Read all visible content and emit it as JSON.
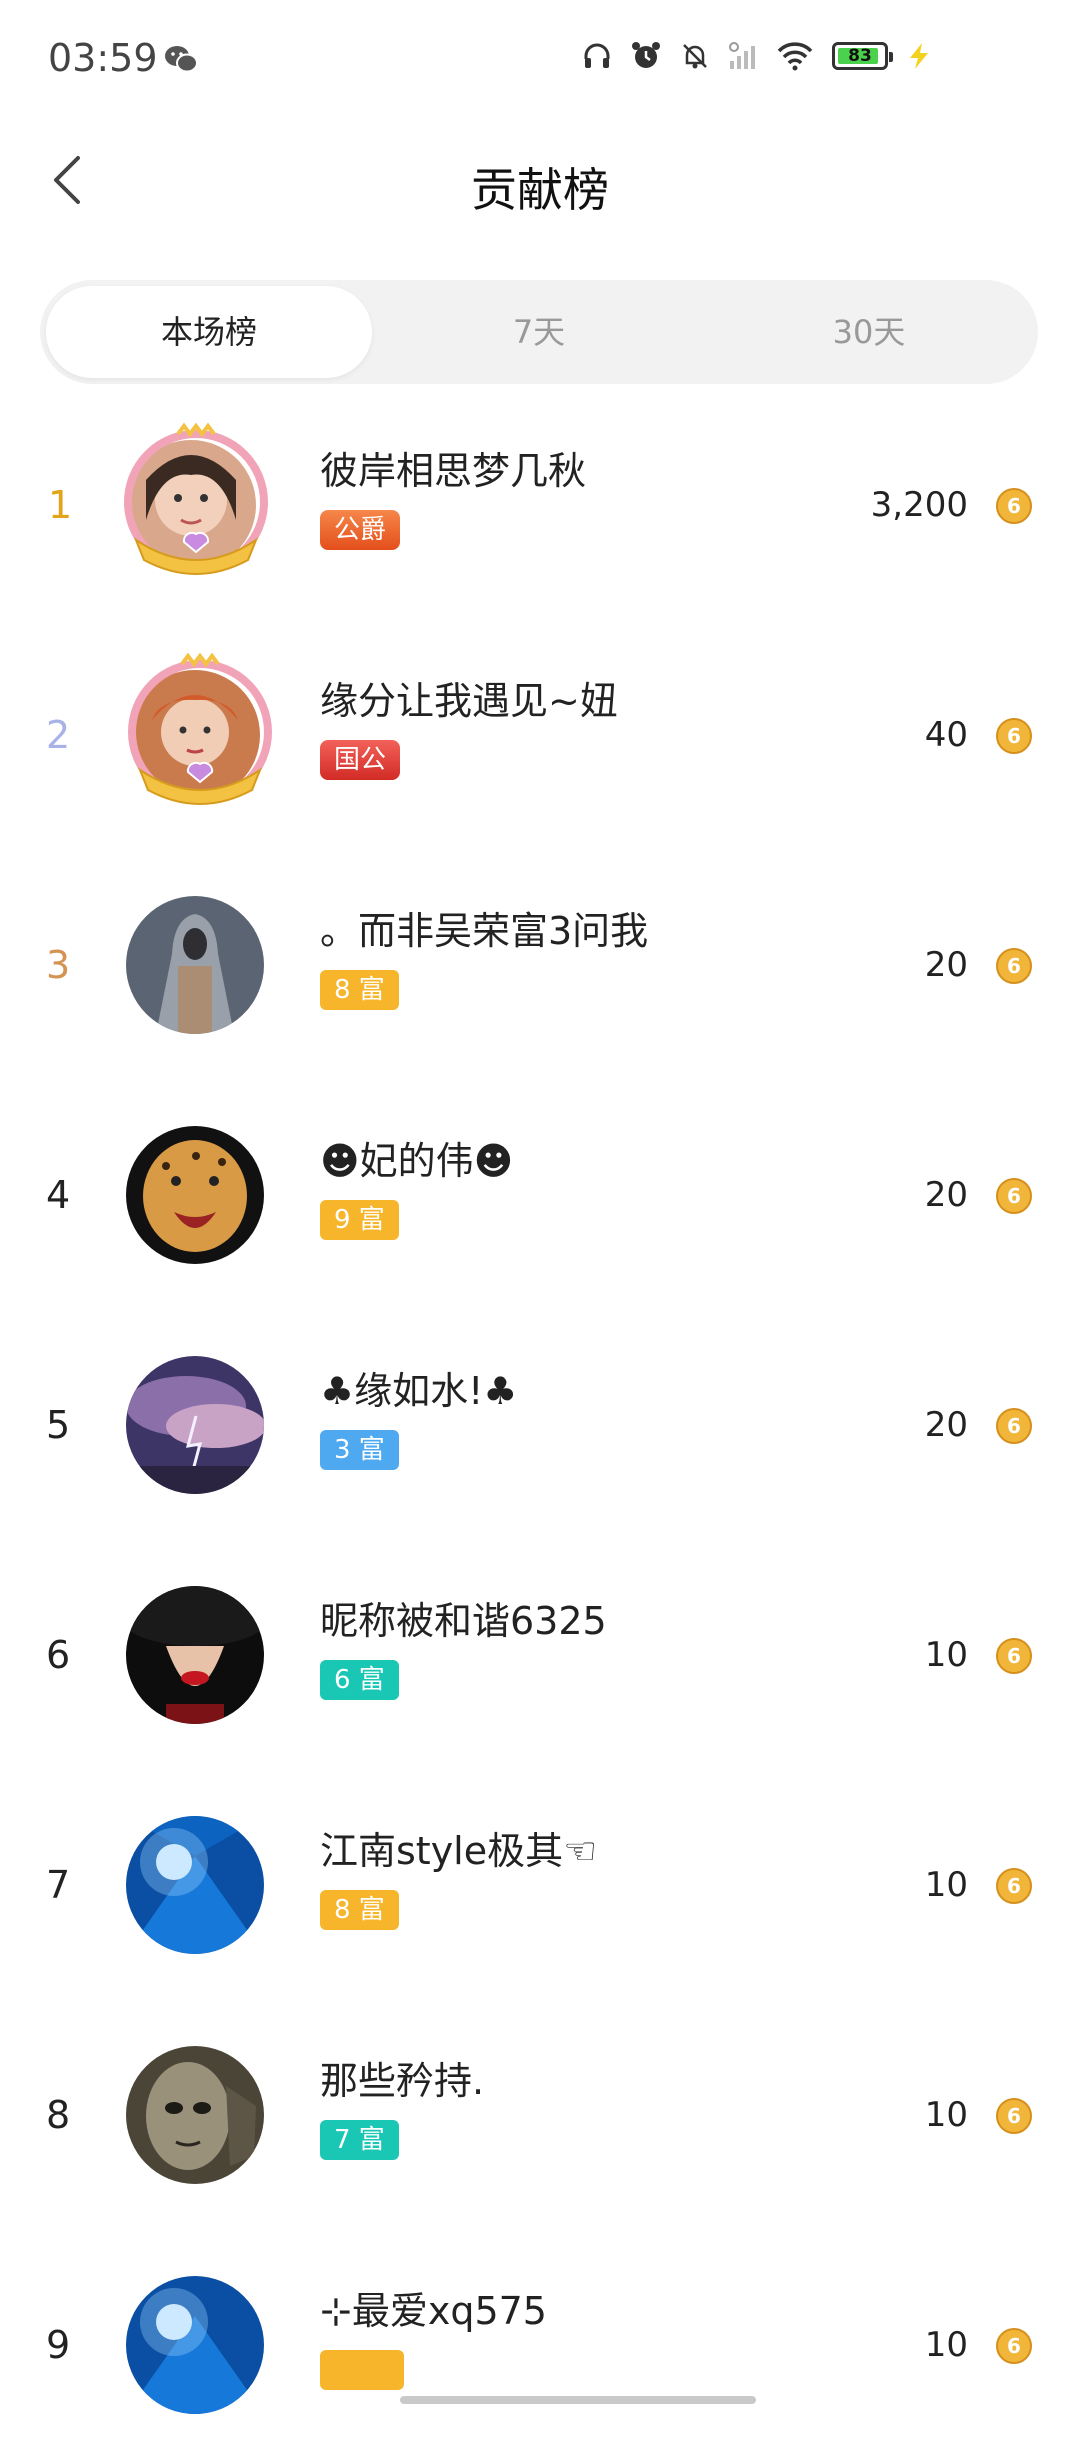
{
  "status_bar": {
    "time": "03:59",
    "battery": "83",
    "icons": [
      "wechat-icon",
      "headphones-icon",
      "alarm-icon",
      "mute-bell-icon",
      "signal-icon",
      "wifi-icon",
      "battery-icon",
      "charging-icon"
    ]
  },
  "header": {
    "title": "贡献榜",
    "back_icon": "chevron-left-icon"
  },
  "tabs": [
    {
      "label": "本场榜",
      "active": true
    },
    {
      "label": "7天",
      "active": false
    },
    {
      "label": "30天",
      "active": false
    }
  ],
  "colors": {
    "rank1": "#e3a419",
    "rank2": "#a8b2e6",
    "rank3": "#d59352",
    "badge_orange": "#f6b52b",
    "badge_blue": "#4ea9f0",
    "badge_teal": "#19c7b4",
    "badge_duke": "#f06a2a",
    "badge_prince": "#e8453c"
  },
  "list": [
    {
      "rank": "1",
      "name": "彼岸相思梦几秋",
      "badge": "公爵",
      "score": "3,200"
    },
    {
      "rank": "2",
      "name": "缘分让我遇见~妞",
      "badge": "国公",
      "score": "40"
    },
    {
      "rank": "3",
      "name": "。而非吴荣富3问我",
      "badge": "8 富",
      "score": "20"
    },
    {
      "rank": "4",
      "name": "☻妃的伟☻",
      "badge": "9 富",
      "score": "20"
    },
    {
      "rank": "5",
      "name": "♣缘如水!♣",
      "badge": "3 富",
      "score": "20"
    },
    {
      "rank": "6",
      "name": "昵称被和谐6325",
      "badge": "6 富",
      "score": "10"
    },
    {
      "rank": "7",
      "name": "江南style极其☜",
      "badge": "8 富",
      "score": "10"
    },
    {
      "rank": "8",
      "name": "那些矜持.",
      "badge": "7 富",
      "score": "10"
    },
    {
      "rank": "9",
      "name": "⊹最爱xq575",
      "badge": "",
      "score": "10"
    }
  ],
  "coin_symbol": "6"
}
